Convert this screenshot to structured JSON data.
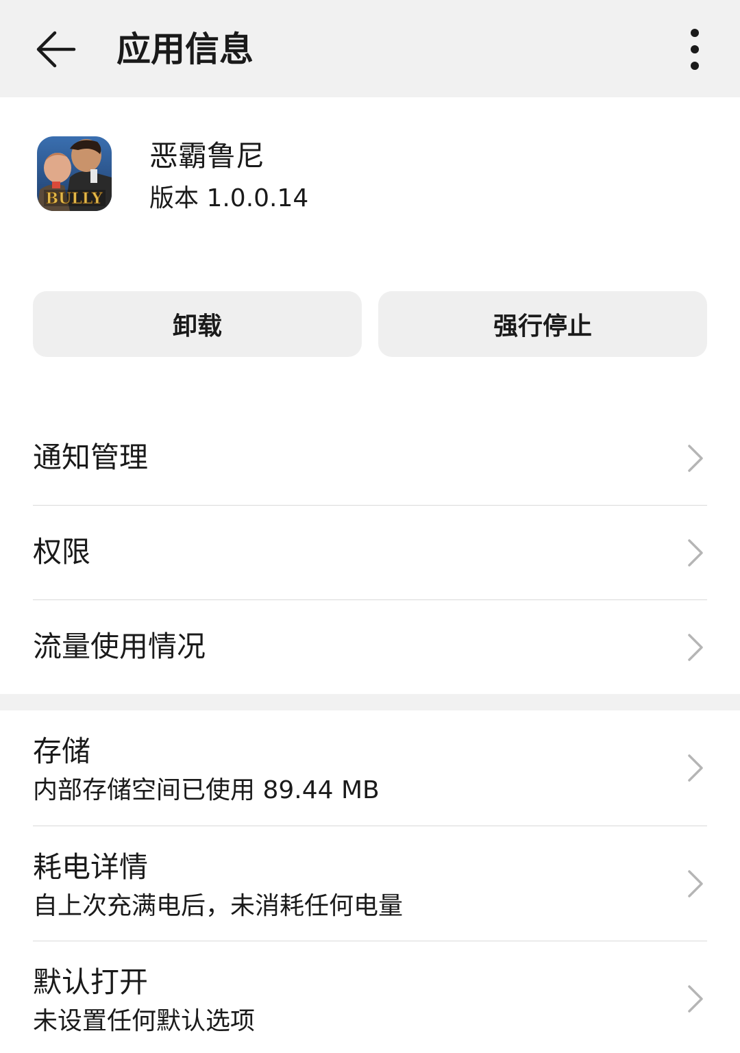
{
  "header": {
    "title": "应用信息"
  },
  "app": {
    "name": "恶霸鲁尼",
    "version": "版本 1.0.0.14",
    "icon_text": "BULLY"
  },
  "actions": {
    "uninstall": "卸载",
    "force_stop": "强行停止"
  },
  "menu": {
    "notifications": "通知管理",
    "permissions": "权限",
    "data_usage": "流量使用情况",
    "storage": {
      "title": "存储",
      "subtitle": "内部存储空间已使用 89.44 MB"
    },
    "battery": {
      "title": "耗电详情",
      "subtitle": "自上次充满电后，未消耗任何电量"
    },
    "open_by_default": {
      "title": "默认打开",
      "subtitle": "未设置任何默认选项"
    }
  }
}
